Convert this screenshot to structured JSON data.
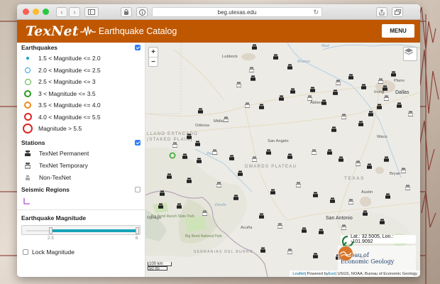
{
  "browser": {
    "url": "beg.utexas.edu"
  },
  "header": {
    "logo": "TexNet",
    "title": "Earthquake Catalog",
    "menu_label": "MENU",
    "brand_color": "#bf5700"
  },
  "panel": {
    "earthquakes": {
      "title": "Earthquakes",
      "checked": true,
      "legend": [
        {
          "label": "1.5 < Magnitude <= 2.0",
          "color": "#1ba1c9",
          "style": "dot"
        },
        {
          "label": "2.0 < Magnitude <= 2.5",
          "color": "#2aa3d6",
          "style": "ring"
        },
        {
          "label": "2.5 < Magnitude <= 3",
          "color": "#4caf3a",
          "style": "ring"
        },
        {
          "label": "3 < Magnitude <= 3.5",
          "color": "#2e9a1f",
          "style": "ring"
        },
        {
          "label": "3.5 < Magnitude <= 4.0",
          "color": "#f08a1c",
          "style": "ring"
        },
        {
          "label": "4.0 < Magnitude <= 5.5",
          "color": "#e02424",
          "style": "ring"
        },
        {
          "label": "Magnitude > 5.5",
          "color": "#e02424",
          "style": "ring"
        }
      ]
    },
    "stations": {
      "title": "Stations",
      "checked": true,
      "items": [
        {
          "label": "TexNet Permanent",
          "icon": "station-permanent-icon"
        },
        {
          "label": "TexNet Temporary",
          "icon": "station-temporary-icon"
        },
        {
          "label": "Non-TexNet",
          "icon": "station-nontexnet-icon"
        }
      ]
    },
    "seismic_regions": {
      "title": "Seismic Regions",
      "checked": false,
      "swatch_color": "#b14cd8"
    },
    "magnitude": {
      "title": "Earthquake Magnitude",
      "min_label": "2.5",
      "max_label": "6",
      "range": [
        1.5,
        6.0
      ],
      "selected": [
        2.5,
        6.0
      ],
      "accent": "#16a2b8"
    },
    "lock_label": "Lock Magnitude"
  },
  "map": {
    "zoom_in": "+",
    "zoom_out": "−",
    "cities": [
      "Lubbock",
      "Plano",
      "Irving",
      "Dallas",
      "Abilene",
      "Midland",
      "Odessa",
      "San Angelo",
      "Waco",
      "Bryan",
      "Austin",
      "San Antonio",
      "Acuña",
      "Ojinaga"
    ],
    "regions": {
      "llano": "LLANO ESTACADO",
      "staked": "(STAKED PLAIN)",
      "edwards": "DWARDS PLATEAU",
      "serranias": "SERRANIAS DEL BURRO",
      "state": "TEXAS"
    },
    "rivers": [
      "Brazos",
      "Pecos",
      "Devils",
      "Red"
    ],
    "park_labels": [
      "Big Bend Ranch State Park",
      "Big Bend National Park"
    ],
    "latlon": "Lat.: 32.5005, Lon.: -101.9092",
    "beg_line1": "Bureau of",
    "beg_line2": "Economic Geology",
    "scale_km": "100 km",
    "scale_mi": "50 mi",
    "attribution": {
      "leaflet": "Leaflet",
      "powered": " | Powered by ",
      "esri": "Esri",
      "rest": " | USGS, NOAA, Bureau of Economic Geology"
    },
    "earthquake_marker_color": "#3aa835"
  }
}
